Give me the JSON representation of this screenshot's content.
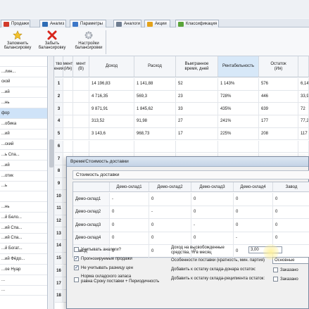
{
  "tabs": [
    {
      "label": "Продажи",
      "color": "#d23b2b"
    },
    {
      "label": "Анализ",
      "color": "#2f6db5"
    },
    {
      "label": "Параметры",
      "color": "#3d78c8"
    },
    {
      "label": "Аналоги",
      "color": "#6f7d90"
    },
    {
      "label": "Акции",
      "color": "#e3a21a"
    },
    {
      "label": "Классификация",
      "color": "#5aa43a"
    }
  ],
  "ribbon": [
    {
      "label": "Запомнить\nбалансировку",
      "icon": "star-icon"
    },
    {
      "label": "Забыть\nбалансировку",
      "icon": "red-x-icon"
    },
    {
      "label": "Настройки\nбалансировки",
      "icon": "gear-icon"
    }
  ],
  "left_list": [
    "",
    "...лин...",
    "ской",
    "...ий",
    "...нь",
    "фор",
    "...обика",
    "...ий",
    "...ский",
    "...ь Спа...",
    "...ий",
    "...отик",
    "...ь",
    "",
    "...нь",
    "...й Белo...",
    "...ий Спа...",
    "...ий Спа...",
    "...й Богат...",
    "...ий Фёдо...",
    "...ое Нуар",
    "...",
    "..."
  ],
  "grid": {
    "headers": [
      "тво\nения",
      "мент\n(Ия)",
      "мент\n(В)",
      "Доход",
      "Расход",
      "Выигранное\nвремя, дней",
      "Рентабельность",
      "Остаток\n(Ия)",
      ""
    ],
    "rows": [
      {
        "idx": "1",
        "c1": "",
        "c2": "",
        "income": "14 196,83",
        "expense": "1 141,88",
        "days": "52",
        "profit": "1 143%",
        "rest": "576",
        "extra": "6,14"
      },
      {
        "idx": "2",
        "c1": "",
        "c2": "",
        "income": "4 716,35",
        "expense": "569,3",
        "days": "23",
        "profit": "728%",
        "rest": "446",
        "extra": "33,9"
      },
      {
        "idx": "3",
        "c1": "",
        "c2": "",
        "income": "9 871,91",
        "expense": "1 845,62",
        "days": "33",
        "profit": "435%",
        "rest": "639",
        "extra": "72"
      },
      {
        "idx": "4",
        "c1": "",
        "c2": "",
        "income": "313,52",
        "expense": "91,98",
        "days": "27",
        "profit": "241%",
        "rest": "177",
        "extra": "77,2"
      },
      {
        "idx": "5",
        "c1": "",
        "c2": "",
        "income": "3 143,6",
        "expense": "968,73",
        "days": "17",
        "profit": "225%",
        "rest": "208",
        "extra": "117"
      },
      {
        "idx": "6",
        "c1": "",
        "c2": "",
        "income": "",
        "expense": "",
        "days": "",
        "profit": "",
        "rest": "",
        "extra": ""
      },
      {
        "idx": "7",
        "c1": "",
        "c2": "",
        "income": "",
        "expense": "",
        "days": "",
        "profit": "",
        "rest": "",
        "extra": ""
      },
      {
        "idx": "8",
        "c1": "",
        "c2": "",
        "income": "",
        "expense": "",
        "days": "",
        "profit": "",
        "rest": "",
        "extra": ""
      },
      {
        "idx": "9",
        "c1": "",
        "c2": "",
        "income": "",
        "expense": "",
        "days": "",
        "profit": "",
        "rest": "",
        "extra": ""
      },
      {
        "idx": "10",
        "c1": "",
        "c2": "",
        "income": "",
        "expense": "",
        "days": "",
        "profit": "",
        "rest": "",
        "extra": ""
      },
      {
        "idx": "11",
        "c1": "",
        "c2": "",
        "income": "",
        "expense": "",
        "days": "",
        "profit": "",
        "rest": "",
        "extra": ""
      },
      {
        "idx": "12",
        "c1": "",
        "c2": "",
        "income": "",
        "expense": "",
        "days": "",
        "profit": "",
        "rest": "",
        "extra": ""
      },
      {
        "idx": "13",
        "c1": "",
        "c2": "",
        "income": "",
        "expense": "",
        "days": "",
        "profit": "",
        "rest": "",
        "extra": ""
      },
      {
        "idx": "14",
        "c1": "",
        "c2": "",
        "income": "",
        "expense": "",
        "days": "",
        "profit": "",
        "rest": "",
        "extra": ""
      },
      {
        "idx": "15",
        "c1": "",
        "c2": "",
        "income": "",
        "expense": "",
        "days": "",
        "profit": "",
        "rest": "",
        "extra": ""
      },
      {
        "idx": "16",
        "c1": "",
        "c2": "",
        "income": "",
        "expense": "",
        "days": "",
        "profit": "",
        "rest": "",
        "extra": ""
      },
      {
        "idx": "17",
        "c1": "",
        "c2": "",
        "income": "",
        "expense": "",
        "days": "",
        "profit": "",
        "rest": "",
        "extra": ""
      },
      {
        "idx": "18",
        "c1": "",
        "c2": "",
        "income": "",
        "expense": "",
        "days": "",
        "profit": "",
        "rest": "",
        "extra": ""
      }
    ]
  },
  "dialog": {
    "title": "Время/Стоимость доставки",
    "group": "Стоимость доставки",
    "columns": [
      "",
      "Демо-склад1",
      "Демо-склад2",
      "Демо-склад3",
      "Демо-склад4",
      "Завод"
    ],
    "rows": [
      [
        "Демо-склад1",
        "-",
        "0",
        "0",
        "0",
        "0"
      ],
      [
        "Демо-склад2",
        "0",
        "-",
        "0",
        "0",
        "0"
      ],
      [
        "Демо-склад3",
        "0",
        "0",
        "-",
        "0",
        "0"
      ],
      [
        "Демо-склад4",
        "0",
        "0",
        "0",
        "-",
        "0"
      ],
      [
        "Завод",
        "0",
        "0",
        "0",
        "0",
        ""
      ]
    ],
    "options": {
      "analogs": "Учитывать аналоги?",
      "forecast": "Прогнозируемые продажи",
      "ignore_price": "Не учитывать разницу цен",
      "norm": "Норма складского запаса\nравна Сроку поставки + Периодичность",
      "income_label": "Доход на высвобожденные\nсредства, % в месяц",
      "income_value": "3,00",
      "supply_label": "Особенности поставки (кратность, мин. партия)",
      "supply_value": "Основные",
      "donor_label": "Добавить к остатку склада-донара остаток:",
      "donor_check": "Заказано",
      "recipient_label": "Добавить к остатку склада-реципиента остаток:",
      "recipient_check": "Заказано"
    }
  }
}
